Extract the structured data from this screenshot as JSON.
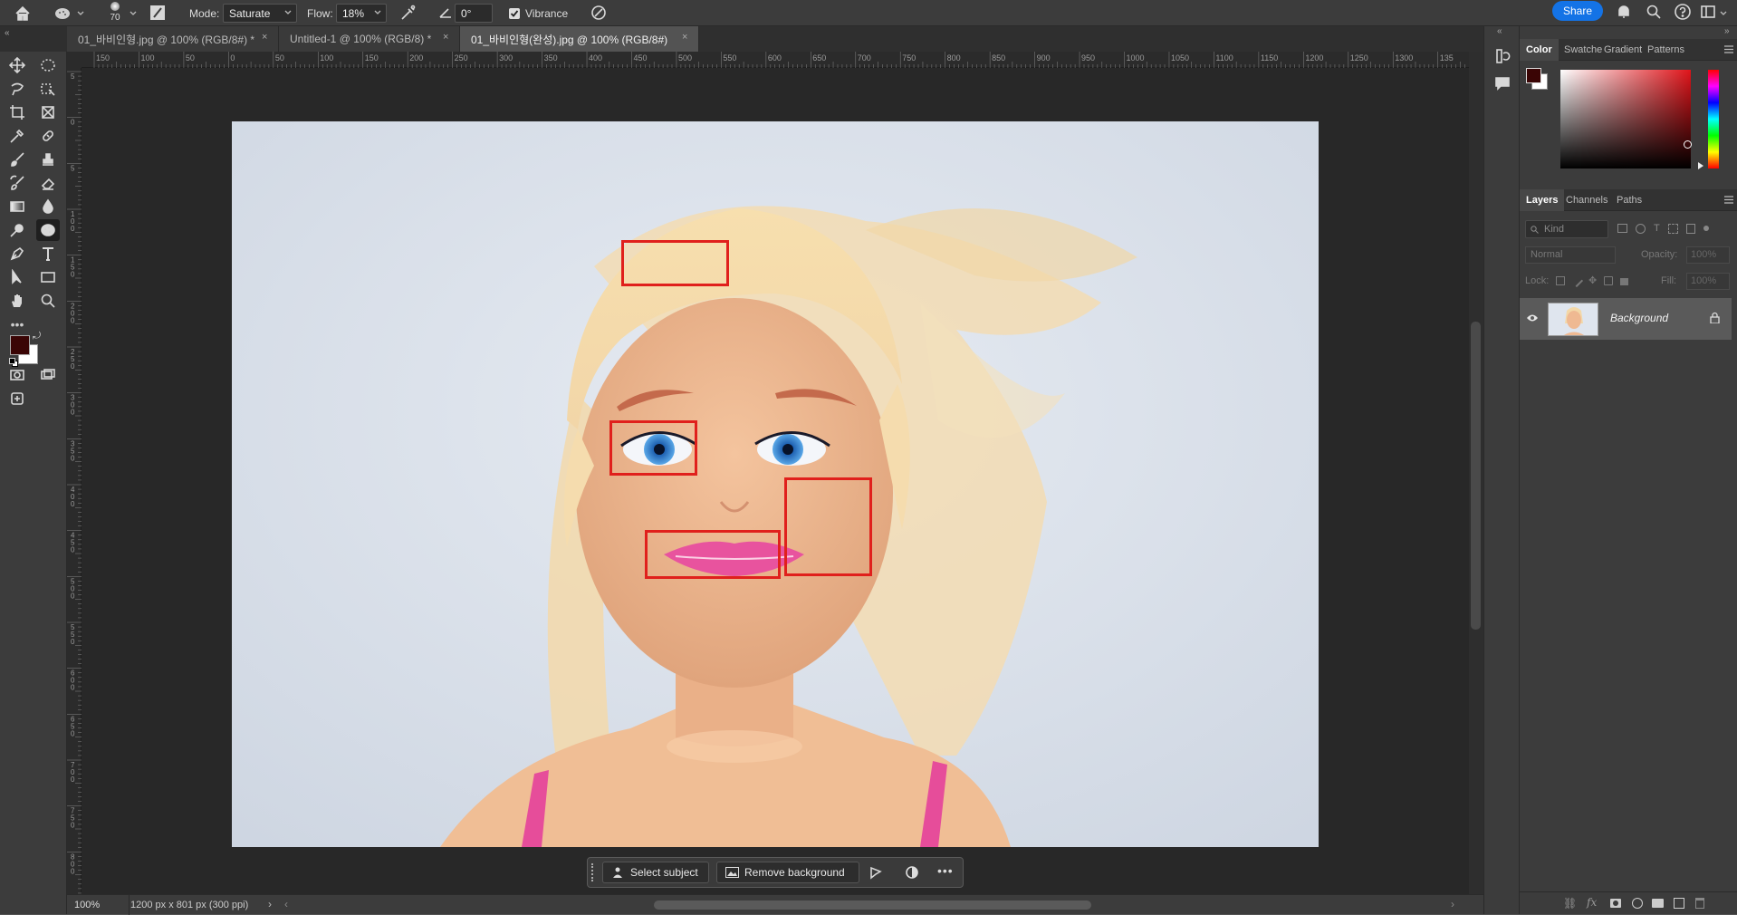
{
  "options_bar": {
    "brush_size": "70",
    "mode_label": "Mode:",
    "mode_value": "Saturate",
    "flow_label": "Flow:",
    "flow_value": "18%",
    "angle_value": "0°",
    "vibrance_label": "Vibrance",
    "vibrance_checked": true,
    "share_label": "Share"
  },
  "tabs": [
    {
      "label": "01_바비인형.jpg @ 100% (RGB/8#) *",
      "active": false
    },
    {
      "label": "Untitled-1 @ 100% (RGB/8) *",
      "active": false
    },
    {
      "label": "01_바비인형(완성).jpg @ 100% (RGB/8#)",
      "active": true
    }
  ],
  "ruler": {
    "h_labels": [
      "150",
      "100",
      "50",
      "0",
      "50",
      "100",
      "150",
      "200",
      "250",
      "300",
      "350",
      "400",
      "450",
      "500",
      "550",
      "600",
      "650",
      "700",
      "750",
      "800",
      "850",
      "900",
      "950",
      "1000",
      "1050",
      "1100",
      "1150",
      "1200",
      "1250",
      "1300",
      "135"
    ],
    "v_labels": [
      "5",
      "0",
      "5",
      "1 0 0",
      "1 5 0",
      "2 0 0",
      "2 5 0",
      "3 0 0",
      "3 5 0",
      "4 0 0",
      "4 5 0",
      "5 0 0",
      "5 5 0",
      "6 0 0",
      "6 5 0",
      "7 0 0",
      "7 5 0",
      "8 0 0"
    ]
  },
  "toolbar": {
    "tools": [
      "move-tool",
      "rect-marquee-tool",
      "lasso-tool",
      "object-select-tool",
      "crop-tool",
      "frame-tool",
      "eyedropper-tool",
      "healing-brush-tool",
      "brush-tool",
      "stamp-tool",
      "history-brush-tool",
      "eraser-tool",
      "gradient-tool",
      "blur-tool",
      "dodge-tool",
      "sponge-tool",
      "pen-tool",
      "type-tool",
      "path-select-tool",
      "rectangle-tool",
      "hand-tool",
      "zoom-tool"
    ],
    "foreground_color": "#3a0505",
    "background_color": "#ffffff"
  },
  "context_taskbar": {
    "select_subject": "Select subject",
    "remove_background": "Remove background"
  },
  "status": {
    "zoom": "100%",
    "doc_info": "1200 px x 801 px (300 ppi)"
  },
  "color_panel": {
    "tabs": [
      "Color",
      "Swatche",
      "Gradient",
      "Patterns"
    ],
    "foreground": "#3a0505"
  },
  "layers_panel": {
    "tabs": [
      "Layers",
      "Channels",
      "Paths"
    ],
    "filter_placeholder": "Kind",
    "blend_mode": "Normal",
    "opacity_label": "Opacity:",
    "opacity_value": "100%",
    "lock_label": "Lock:",
    "fill_label": "Fill:",
    "fill_value": "100%",
    "layers": [
      {
        "name": "Background",
        "visible": true,
        "locked": true
      }
    ]
  },
  "annotations": {
    "highlight_color": "#e0201c",
    "count": 4
  },
  "colors": {
    "accent": "#1473e6",
    "panel_bg": "#3c3c3c",
    "canvas_bg": "#282828"
  }
}
